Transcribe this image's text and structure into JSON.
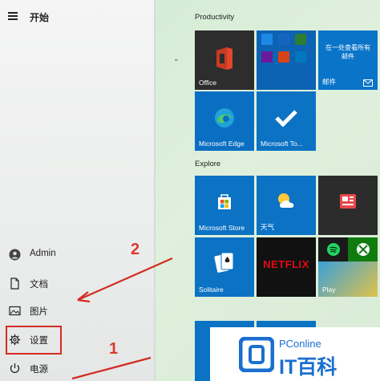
{
  "start_menu": {
    "title": "开始"
  },
  "rail": [
    {
      "name": "user-item",
      "icon": "user-avatar-icon",
      "label": "Admin"
    },
    {
      "name": "documents-item",
      "icon": "document-icon",
      "label": "文档"
    },
    {
      "name": "pictures-item",
      "icon": "picture-icon",
      "label": "图片"
    },
    {
      "name": "settings-item",
      "icon": "gear-icon",
      "label": "设置"
    },
    {
      "name": "power-item",
      "icon": "power-icon",
      "label": "电源"
    }
  ],
  "sections": {
    "productivity": "Productivity",
    "explore": "Explore"
  },
  "tiles": {
    "office": "Office",
    "mail_line1": "在一处查看所有",
    "mail_line2": "邮件",
    "mail": "邮件",
    "edge": "Microsoft Edge",
    "todo": "Microsoft To...",
    "store": "Microsoft Store",
    "weather": "天气",
    "netflix": "NETFLIX",
    "solitaire": "Solitaire",
    "play": "Play"
  },
  "annotations": {
    "number_1": "1",
    "number_2": "2"
  },
  "watermark": {
    "brand": "PConline",
    "name": "IT百科"
  },
  "colors": {
    "tile_blue": "#0b72c4",
    "tile_dark": "#2c2c2c",
    "annotation_red": "#d32b22"
  }
}
